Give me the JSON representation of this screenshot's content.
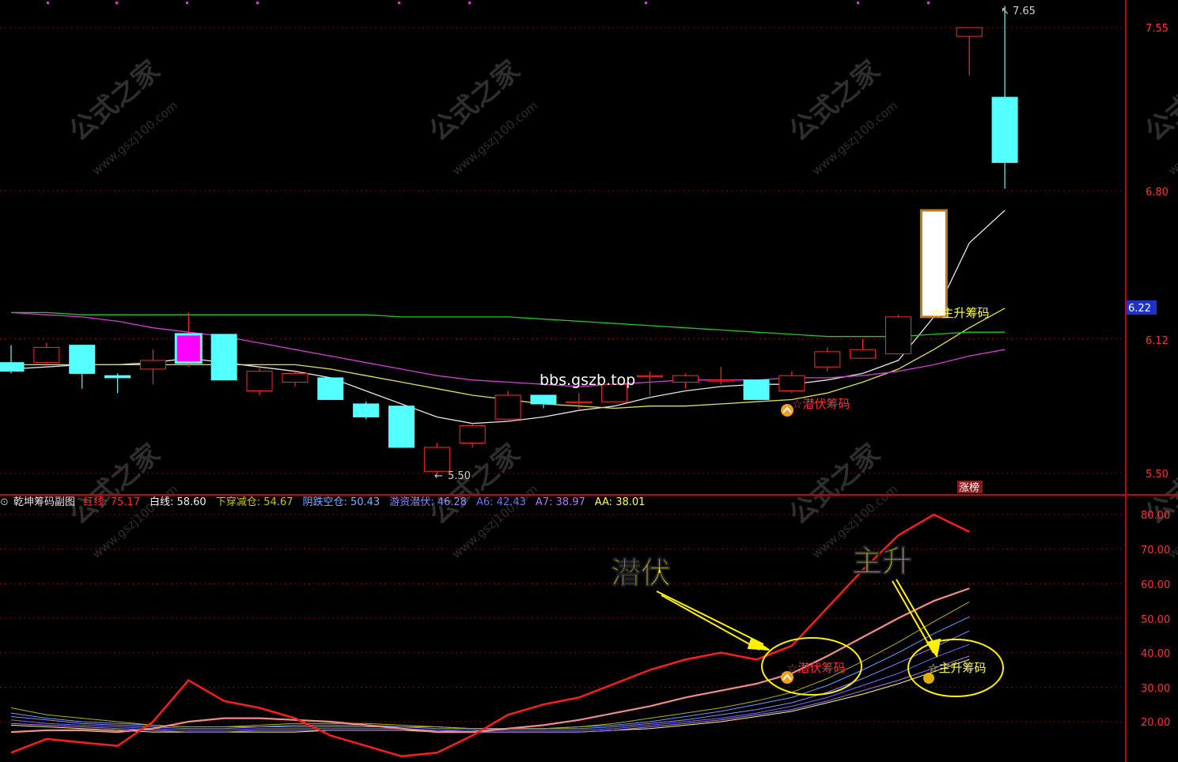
{
  "colors": {
    "up": "#ff2a2a",
    "down": "#54ffff",
    "ma_white": "#e6e6e6",
    "ma_yellow": "#e2e246",
    "ma_purple": "#d43cd4",
    "ma_green": "#22c822",
    "grid": "#8c0000",
    "axis": "#c80000",
    "red_line": "#ff1e1e",
    "pink_line": "#f08c8c",
    "annotation": "#fff200"
  },
  "main_chart": {
    "price_labels": [
      "7.55",
      "6.80",
      "6.12",
      "5.50"
    ],
    "current_price": "6.22",
    "high_label": "7.65",
    "low_label": "5.50",
    "watermark_center": "bbs.gszb.top",
    "signal_qianfu": "☆潜伏筹码",
    "signal_zhusheng": "☆主升筹码",
    "zhangbang_label": "涨榜"
  },
  "indicator": {
    "name": "乾坤筹码副图",
    "legend": [
      {
        "label": "红线:",
        "value": "75.17",
        "color": "#ff2a2a"
      },
      {
        "label": "白线:",
        "value": "58.60",
        "color": "#f0f0f0"
      },
      {
        "label": "下穿减仓:",
        "value": "54.67",
        "color": "#c8c800"
      },
      {
        "label": "阴跌空仓:",
        "value": "50.43",
        "color": "#78b4ff"
      },
      {
        "label": "游资潜伏:",
        "value": "46.28",
        "color": "#8c8cff"
      },
      {
        "label": "A6:",
        "value": "42.43",
        "color": "#6e6eff"
      },
      {
        "label": "A7:",
        "value": "38.97",
        "color": "#b478ff"
      },
      {
        "label": "AA:",
        "value": "38.01",
        "color": "#ffff64"
      }
    ],
    "axis_labels": [
      "80.00",
      "70.00",
      "60.00",
      "50.00",
      "40.00",
      "30.00",
      "20.00"
    ],
    "annotation_qianfu": "潜伏",
    "annotation_zhusheng": "主升",
    "signal_qianfu": "☆潜伏筹码",
    "signal_zhusheng": "☆主升筹码"
  },
  "chart_data": [
    {
      "type": "candlestick",
      "title": "",
      "ylim": [
        5.45,
        7.7
      ],
      "y_ticks": [
        7.55,
        6.8,
        6.12,
        5.5
      ],
      "candles": [
        {
          "o": 6.01,
          "h": 6.09,
          "l": 5.96,
          "c": 5.97
        },
        {
          "o": 6.01,
          "h": 6.1,
          "l": 5.99,
          "c": 6.08
        },
        {
          "o": 6.09,
          "h": 6.09,
          "l": 5.89,
          "c": 5.96
        },
        {
          "o": 5.95,
          "h": 5.96,
          "l": 5.87,
          "c": 5.94
        },
        {
          "o": 5.98,
          "h": 6.07,
          "l": 5.91,
          "c": 6.02
        },
        {
          "o": 6.01,
          "h": 6.24,
          "l": 5.99,
          "c": 6.14
        },
        {
          "o": 6.14,
          "h": 6.14,
          "l": 5.93,
          "c": 5.93
        },
        {
          "o": 5.88,
          "h": 5.99,
          "l": 5.86,
          "c": 5.97
        },
        {
          "o": 5.92,
          "h": 5.97,
          "l": 5.9,
          "c": 5.96
        },
        {
          "o": 5.94,
          "h": 5.94,
          "l": 5.84,
          "c": 5.84
        },
        {
          "o": 5.82,
          "h": 5.83,
          "l": 5.75,
          "c": 5.76
        },
        {
          "o": 5.81,
          "h": 5.81,
          "l": 5.62,
          "c": 5.62
        },
        {
          "o": 5.51,
          "h": 5.64,
          "l": 5.5,
          "c": 5.62
        },
        {
          "o": 5.64,
          "h": 5.73,
          "l": 5.62,
          "c": 5.72
        },
        {
          "o": 5.75,
          "h": 5.88,
          "l": 5.75,
          "c": 5.86
        },
        {
          "o": 5.86,
          "h": 5.86,
          "l": 5.8,
          "c": 5.82
        },
        {
          "o": 5.83,
          "h": 5.87,
          "l": 5.79,
          "c": 5.83
        },
        {
          "o": 5.83,
          "h": 5.91,
          "l": 5.83,
          "c": 5.91
        },
        {
          "o": 5.95,
          "h": 5.97,
          "l": 5.86,
          "c": 5.95
        },
        {
          "o": 5.92,
          "h": 5.96,
          "l": 5.89,
          "c": 5.95
        },
        {
          "o": 5.93,
          "h": 5.99,
          "l": 5.91,
          "c": 5.93
        },
        {
          "o": 5.93,
          "h": 5.93,
          "l": 5.84,
          "c": 5.84
        },
        {
          "o": 5.88,
          "h": 5.97,
          "l": 5.87,
          "c": 5.95
        },
        {
          "o": 5.99,
          "h": 6.08,
          "l": 5.97,
          "c": 6.06
        },
        {
          "o": 6.03,
          "h": 6.12,
          "l": 6.03,
          "c": 6.07
        },
        {
          "o": 6.05,
          "h": 6.23,
          "l": 6.05,
          "c": 6.22
        },
        {
          "o": 6.22,
          "h": 6.71,
          "l": 6.22,
          "c": 6.71
        },
        {
          "o": 7.51,
          "h": 7.55,
          "l": 7.33,
          "c": 7.55
        },
        {
          "o": 7.23,
          "h": 7.65,
          "l": 6.81,
          "c": 6.93
        }
      ],
      "series": [
        {
          "name": "",
          "values": [
            5.98,
            5.99,
            6.0,
            6.0,
            6.01,
            6.03,
            6.01,
            5.99,
            5.97,
            5.94,
            5.88,
            5.82,
            5.76,
            5.73,
            5.74,
            5.76,
            5.79,
            5.81,
            5.85,
            5.88,
            5.9,
            5.91,
            5.91,
            5.93,
            5.96,
            6.02,
            6.22,
            6.56,
            6.71
          ]
        },
        {
          "name": "",
          "values": [
            6.0,
            6.0,
            6.0,
            6.0,
            6.0,
            6.0,
            6.0,
            6.0,
            6.0,
            5.98,
            5.95,
            5.92,
            5.89,
            5.86,
            5.84,
            5.82,
            5.81,
            5.8,
            5.81,
            5.81,
            5.82,
            5.83,
            5.84,
            5.87,
            5.92,
            5.98,
            6.07,
            6.17,
            6.26
          ]
        },
        {
          "name": "",
          "values": [
            6.24,
            6.23,
            6.22,
            6.2,
            6.17,
            6.15,
            6.13,
            6.1,
            6.07,
            6.04,
            6.01,
            5.98,
            5.95,
            5.93,
            5.92,
            5.91,
            5.9,
            5.91,
            5.92,
            5.93,
            5.93,
            5.93,
            5.94,
            5.94,
            5.95,
            5.97,
            6.0,
            6.04,
            6.07
          ]
        },
        {
          "name": "",
          "values": [
            6.24,
            6.24,
            6.23,
            6.23,
            6.23,
            6.23,
            6.23,
            6.23,
            6.23,
            6.23,
            6.23,
            6.22,
            6.22,
            6.22,
            6.22,
            6.21,
            6.2,
            6.19,
            6.18,
            6.17,
            6.16,
            6.15,
            6.14,
            6.13,
            6.13,
            6.13,
            6.14,
            6.15,
            6.15
          ]
        }
      ]
    },
    {
      "type": "line",
      "title": "乾坤筹码副图",
      "ylim": [
        14,
        84
      ],
      "y_ticks": [
        80,
        70,
        60,
        50,
        40,
        30,
        20
      ],
      "series": [
        {
          "name": "红线",
          "values": [
            11,
            15,
            14,
            13,
            20,
            32,
            26,
            24,
            21,
            16,
            13,
            10,
            11,
            16,
            22,
            25,
            27,
            31,
            35,
            38,
            40,
            38,
            42,
            53,
            64,
            74,
            80,
            75
          ]
        },
        {
          "name": "白线",
          "values": [
            17,
            17.5,
            17.5,
            17,
            18,
            20,
            21,
            21,
            20.5,
            20,
            19,
            18,
            17,
            17,
            18,
            19,
            20.5,
            22.5,
            24.5,
            27,
            29,
            31,
            34,
            39,
            44.5,
            50,
            55,
            58.6
          ]
        },
        {
          "name": "下穿减仓",
          "values": [
            24,
            22,
            21,
            20,
            19,
            18.5,
            18.5,
            19,
            19.5,
            19.5,
            19.5,
            19,
            18.5,
            18,
            18,
            18,
            18.5,
            19.5,
            21,
            22.5,
            24,
            26,
            28.5,
            32.5,
            37.5,
            43,
            49,
            54.7
          ]
        },
        {
          "name": "阴跌空仓",
          "values": [
            22.5,
            21,
            20,
            19.5,
            19,
            18.5,
            18.5,
            18.5,
            19,
            19,
            19,
            18.5,
            18.5,
            18,
            18,
            18,
            18.5,
            19,
            20,
            21.5,
            23,
            25,
            27,
            30.5,
            35,
            40,
            45.5,
            50.4
          ]
        },
        {
          "name": "游资潜伏",
          "values": [
            21.5,
            20.5,
            19.5,
            19,
            18.5,
            18,
            18,
            18.5,
            18.5,
            18.5,
            18.5,
            18.5,
            18,
            18,
            18,
            18,
            18,
            18.5,
            19.5,
            20.5,
            22,
            23.5,
            25.5,
            28.5,
            32.5,
            37,
            41.5,
            46.3
          ]
        },
        {
          "name": "A6",
          "values": [
            20.5,
            19.5,
            19,
            18.5,
            18,
            17.5,
            17.5,
            18,
            18,
            18,
            18,
            18,
            17.5,
            17.5,
            17.5,
            17.5,
            17.5,
            18,
            19,
            20,
            21,
            22.5,
            24.5,
            27,
            30.5,
            34,
            38.5,
            42.4
          ]
        },
        {
          "name": "A7",
          "values": [
            19.5,
            19,
            18.5,
            18,
            17.5,
            17,
            17,
            17.5,
            17.5,
            17.5,
            17.5,
            17.5,
            17.5,
            17,
            17,
            17,
            17,
            17.5,
            18.5,
            19.5,
            20.5,
            22,
            23.5,
            26,
            29,
            32,
            35.5,
            39
          ]
        },
        {
          "name": "AA",
          "values": [
            19,
            18.5,
            18,
            17.5,
            17,
            17,
            17,
            17,
            17,
            17.5,
            17.5,
            17.5,
            17,
            17,
            17,
            17,
            17,
            17.5,
            18,
            19,
            20,
            21.5,
            23,
            25.5,
            28,
            31,
            34.5,
            38
          ]
        }
      ]
    }
  ]
}
